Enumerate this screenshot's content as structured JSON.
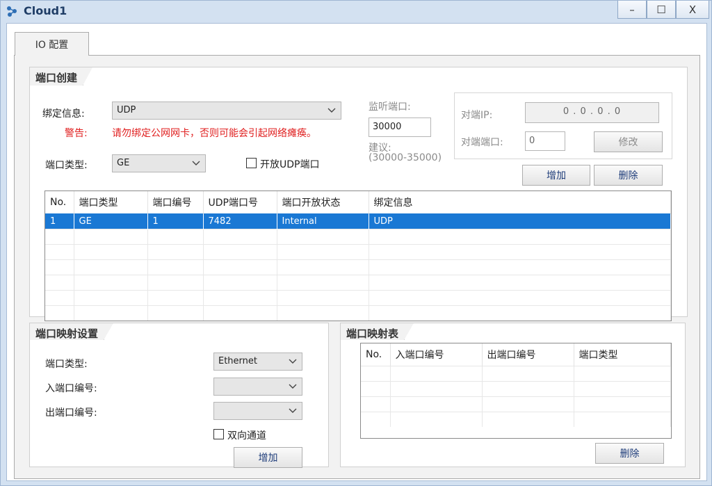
{
  "window": {
    "title": "Cloud1",
    "minimize": "–",
    "maximize": "☐",
    "close": "X"
  },
  "tabs": [
    {
      "label": "IO 配置"
    }
  ],
  "port_create": {
    "title": "端口创建",
    "bind_info_label": "绑定信息:",
    "bind_info_value": "UDP",
    "warning_label": "警告:",
    "warning_text": "请勿绑定公网网卡，否则可能会引起网络瘫痪。",
    "port_type_label": "端口类型:",
    "port_type_value": "GE",
    "open_udp_label": "开放UDP端口",
    "listen_port_label": "监听端口:",
    "listen_port_value": "30000",
    "suggest_label": "建议:",
    "suggest_range": "(30000-35000)",
    "peer_ip_label": "对端IP:",
    "peer_ip_value": "0 . 0 . 0 . 0",
    "peer_port_label": "对端端口:",
    "peer_port_value": "0",
    "modify_button": "修改",
    "add_button": "增加",
    "delete_button": "删除",
    "table": {
      "columns": [
        "No.",
        "端口类型",
        "端口编号",
        "UDP端口号",
        "端口开放状态",
        "绑定信息"
      ],
      "rows": [
        [
          "1",
          "GE",
          "1",
          "7482",
          "Internal",
          "UDP"
        ]
      ]
    }
  },
  "port_mapping_settings": {
    "title": "端口映射设置",
    "port_type_label": "端口类型:",
    "port_type_value": "Ethernet",
    "in_port_label": "入端口编号:",
    "out_port_label": "出端口编号:",
    "bidirectional_label": "双向通道",
    "add_button": "增加"
  },
  "port_mapping_table": {
    "title": "端口映射表",
    "columns": [
      "No.",
      "入端口编号",
      "出端口编号",
      "端口类型"
    ],
    "delete_button": "删除"
  }
}
